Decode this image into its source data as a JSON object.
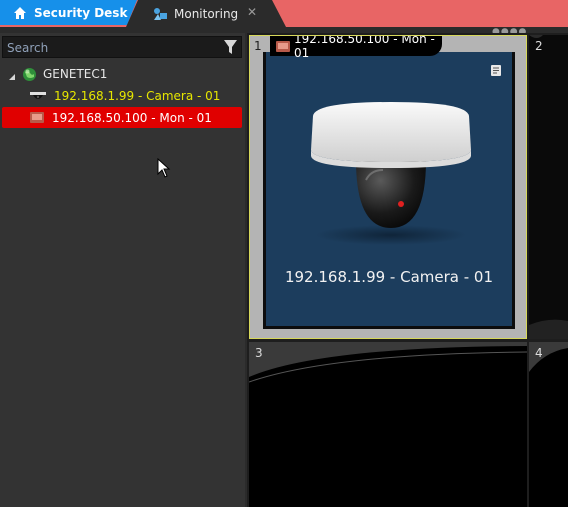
{
  "tabs": {
    "home": {
      "label": "Security Desk",
      "icon": "home-icon"
    },
    "monitoring": {
      "label": "Monitoring",
      "icon": "monitoring-icon",
      "close": "✕"
    }
  },
  "search": {
    "placeholder": "Search",
    "value": ""
  },
  "tree": {
    "root": {
      "label": "GENETEC1",
      "icon": "globe-icon"
    },
    "items": [
      {
        "label": "192.168.1.99 - Camera - 01",
        "icon": "camera-icon",
        "color": "#e6e600"
      },
      {
        "label": "192.168.50.100 - Mon - 01",
        "icon": "monitor-icon",
        "selected": true,
        "highlight": "#e00000"
      }
    ]
  },
  "tiles": [
    {
      "number": "1",
      "title": "192.168.50.100 - Mon - 01",
      "caption": "192.168.1.99 - Camera - 01",
      "selected": true
    },
    {
      "number": "2"
    },
    {
      "number": "3"
    },
    {
      "number": "4"
    }
  ],
  "colors": {
    "home_tab": "#1690ea",
    "tabbar": "#e86565",
    "selection": "#e00000",
    "tile_highlight": "#d7d85a",
    "video_bg": "#1c3d5d"
  }
}
